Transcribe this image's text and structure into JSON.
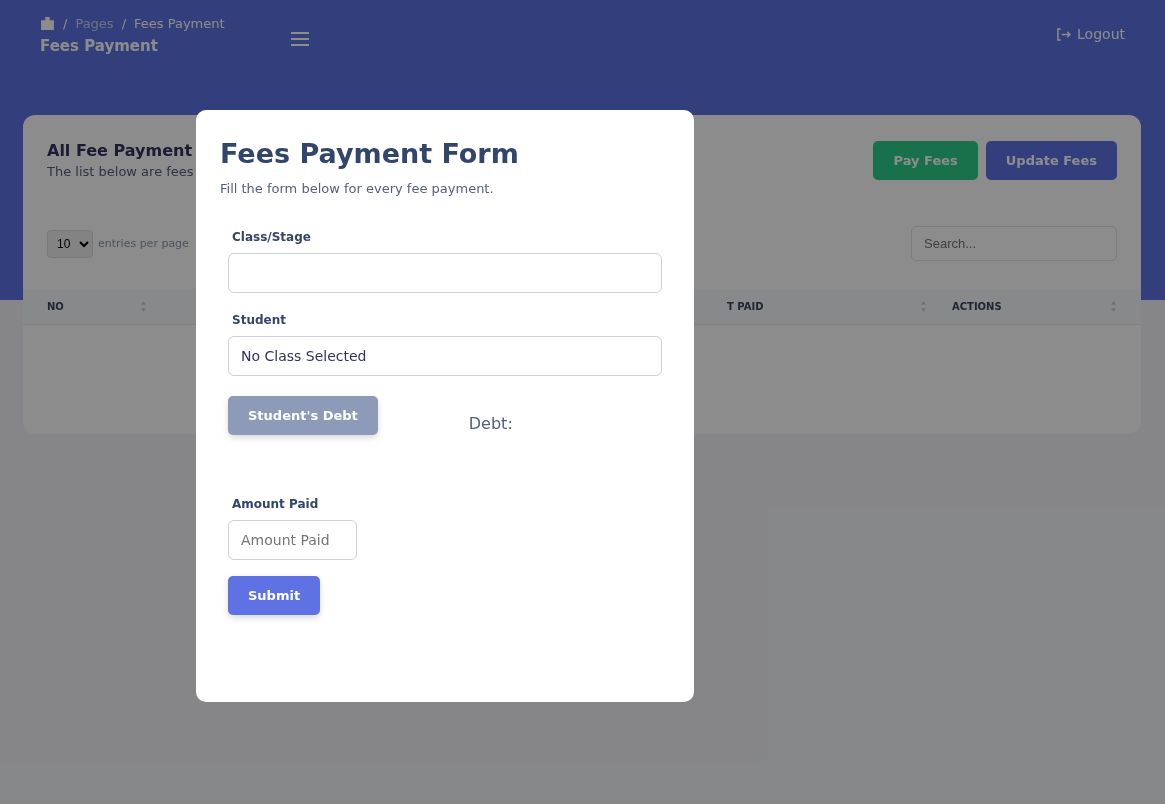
{
  "breadcrumb": {
    "separator": "/",
    "items": [
      "Pages",
      "Fees Payment"
    ],
    "title": "Fees Payment"
  },
  "header": {
    "logout": "Logout"
  },
  "card": {
    "title": "All Fee Payment",
    "subtitle": "The list below are fees",
    "buttons": [
      {
        "label": "Pay Fees",
        "kind": "success"
      },
      {
        "label": "Update Fees",
        "kind": "primary"
      }
    ],
    "entries": {
      "value": "10",
      "label": "entries per page"
    },
    "search": {
      "placeholder": "Search..."
    },
    "columns": [
      "NO",
      "T PAID",
      "ACTIONS"
    ]
  },
  "modal": {
    "title": "Fees Payment Form",
    "subtitle": "Fill the form below for every fee payment.",
    "class_field": {
      "label": "Class/Stage"
    },
    "student_field": {
      "label": "Student",
      "value": "No Class Selected"
    },
    "debt_button": {
      "label": "Student's Debt",
      "disabled": true
    },
    "debt_label": "Debt:",
    "amount_field": {
      "label": "Amount Paid",
      "placeholder": "Amount Paid"
    },
    "submit": "Submit"
  }
}
